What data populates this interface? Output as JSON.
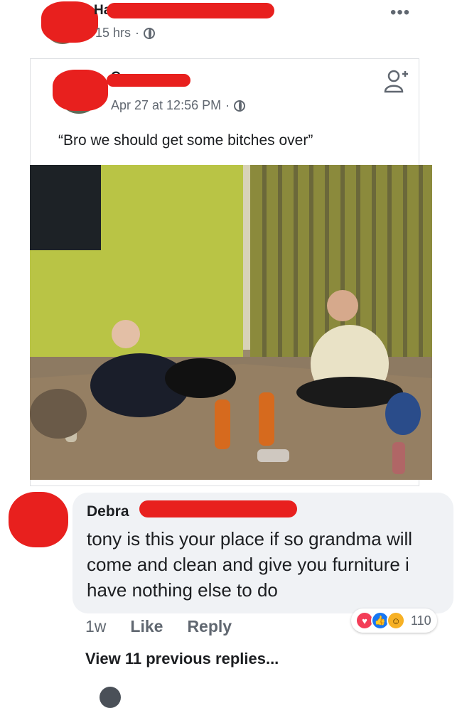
{
  "post": {
    "author_visible": "Ha",
    "time": "15 hrs",
    "more_label": "•••"
  },
  "shared": {
    "author_visible": "C",
    "date": "Apr 27 at 12:56 PM",
    "text": "“Bro we should get some bitches over”"
  },
  "comment": {
    "author_visible": "Debra",
    "text": "tony is this your place if so grandma will come and clean and give you furniture i have nothing else to do",
    "time": "1w",
    "like_label": "Like",
    "reply_label": "Reply",
    "reaction_count": "110",
    "reactions": [
      "love",
      "like",
      "haha"
    ]
  },
  "view_replies": "View 11 previous replies...",
  "colors": {
    "redaction": "#e8201e",
    "bubble": "#f0f2f5",
    "meta_text": "#606770",
    "like_blue": "#1877f2",
    "love_red": "#f33e58",
    "haha_yellow": "#f7b125"
  },
  "icons": [
    "globe-icon",
    "more-icon",
    "add-friend-icon",
    "love-reaction-icon",
    "like-reaction-icon",
    "haha-reaction-icon"
  ]
}
